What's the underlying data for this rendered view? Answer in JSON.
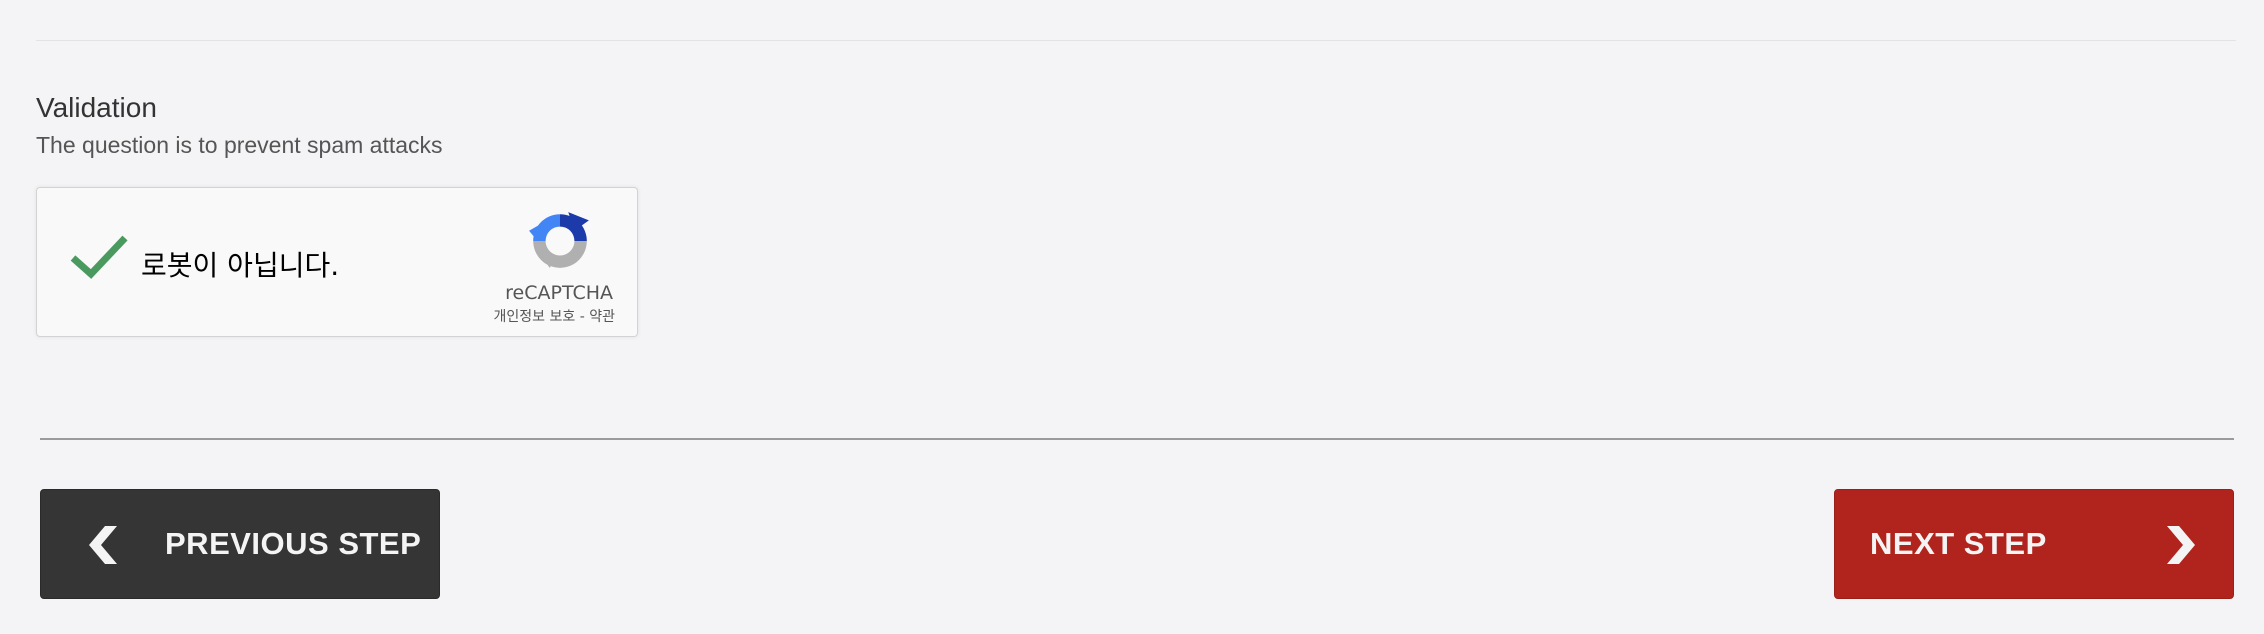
{
  "validation": {
    "title": "Validation",
    "subtitle": "The question is to prevent spam attacks"
  },
  "recaptcha": {
    "checked": true,
    "label": "로봇이 아닙니다.",
    "brand": "reCAPTCHA",
    "links": "개인정보 보호 - 약관",
    "icons": {
      "check": "checkmark-icon",
      "logo": "recaptcha-logo-icon"
    },
    "colors": {
      "check": "#4a9a5f",
      "logo_blue_dark": "#1c3aa9",
      "logo_blue_light": "#4285f4",
      "logo_gray": "#b0b0b0"
    }
  },
  "navigation": {
    "previous_label": "PREVIOUS STEP",
    "next_label": "NEXT STEP",
    "icons": {
      "previous": "chevron-left-icon",
      "next": "chevron-right-icon"
    },
    "colors": {
      "previous_bg": "#353535",
      "next_bg": "#b0241d"
    }
  }
}
